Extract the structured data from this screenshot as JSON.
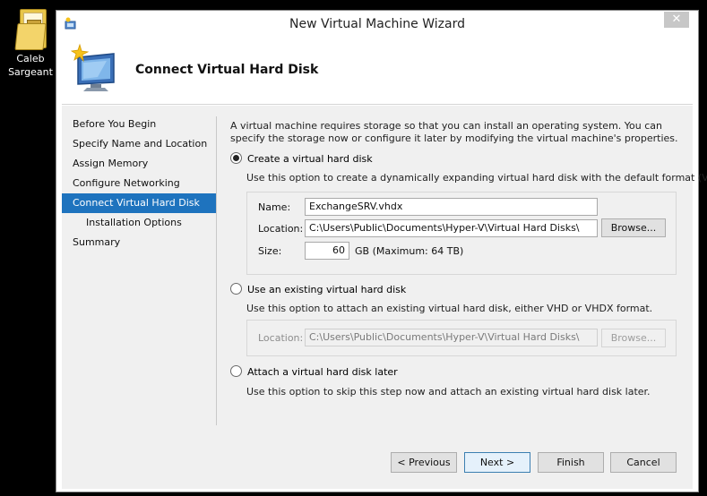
{
  "desktop": {
    "icon_label_line1": "Caleb",
    "icon_label_line2": "Sargeant"
  },
  "window": {
    "title": "New Virtual Machine Wizard",
    "close_glyph": "✕",
    "page_title": "Connect Virtual Hard Disk"
  },
  "nav": {
    "items": [
      {
        "label": "Before You Begin"
      },
      {
        "label": "Specify Name and Location"
      },
      {
        "label": "Assign Memory"
      },
      {
        "label": "Configure Networking"
      },
      {
        "label": "Connect Virtual Hard Disk"
      },
      {
        "label": "Installation Options"
      },
      {
        "label": "Summary"
      }
    ],
    "active_index": 4
  },
  "content": {
    "description": "A virtual machine requires storage so that you can install an operating system. You can specify the storage now or configure it later by modifying the virtual machine's properties.",
    "option_create": {
      "label": "Create a virtual hard disk",
      "selected": true,
      "hint": "Use this option to create a dynamically expanding virtual hard disk with the default format (VHDX).",
      "name_label": "Name:",
      "name_value": "ExchangeSRV.vhdx",
      "location_label": "Location:",
      "location_value": "C:\\Users\\Public\\Documents\\Hyper-V\\Virtual Hard Disks\\",
      "browse_label": "Browse...",
      "size_label": "Size:",
      "size_value": "60",
      "size_suffix": "GB (Maximum: 64 TB)"
    },
    "option_existing": {
      "label": "Use an existing virtual hard disk",
      "selected": false,
      "hint": "Use this option to attach an existing virtual hard disk, either VHD or VHDX format.",
      "location_label": "Location:",
      "location_value": "C:\\Users\\Public\\Documents\\Hyper-V\\Virtual Hard Disks\\",
      "browse_label": "Browse..."
    },
    "option_later": {
      "label": "Attach a virtual hard disk later",
      "selected": false,
      "hint": "Use this option to skip this step now and attach an existing virtual hard disk later."
    }
  },
  "footer": {
    "previous_label": "< Previous",
    "next_label": "Next >",
    "finish_label": "Finish",
    "cancel_label": "Cancel"
  }
}
